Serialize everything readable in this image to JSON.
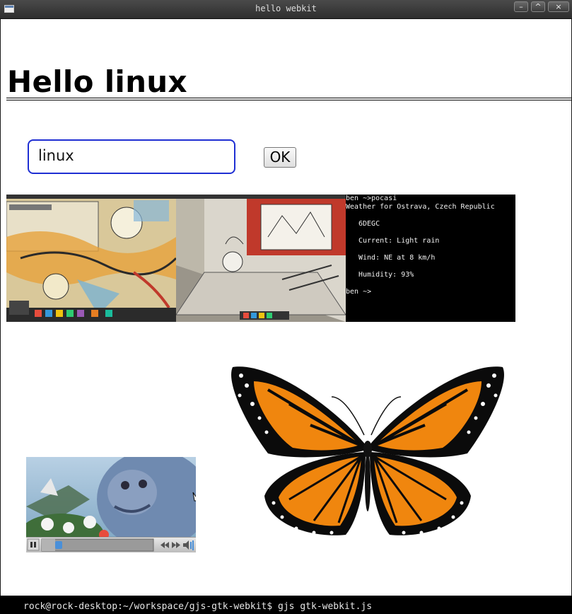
{
  "window": {
    "title": "hello webkit",
    "minimize_glyph": "–",
    "maximize_glyph": "^",
    "close_glyph": "×"
  },
  "page": {
    "heading": "Hello linux",
    "search_value": "linux",
    "ok_label": "OK"
  },
  "thumbnails": [
    {
      "name": "desktop-screenshot-collage",
      "icon": "image"
    },
    {
      "name": "desktop-screenshot-sketch-room",
      "icon": "image"
    },
    {
      "name": "terminal-weather-screenshot",
      "icon": "image"
    }
  ],
  "terminal": {
    "prompt_cmd": "ben ~>pocasi",
    "header": "Weather for Ostrava, Czech Republic",
    "temp": "6DEGC",
    "current": "Current: Light rain",
    "wind": "Wind: NE at 8 km/h",
    "humidity": "Humidity: 93%",
    "prompt_end": "ben ~>"
  },
  "video": {
    "state": "paused",
    "progress": 0.12,
    "pause_icon": "pause-icon",
    "rewind_icon": "rewind-icon",
    "forward_icon": "forward-icon",
    "volume_icon": "volume-icon"
  },
  "taskbar": {
    "command": "rock@rock-desktop:~/workspace/gjs-gtk-webkit$ gjs gtk-webkit.js"
  },
  "colors": {
    "input_border": "#1f2fd3",
    "butterfly_orange": "#f0860e",
    "titlebar": "#3a3a3a"
  }
}
